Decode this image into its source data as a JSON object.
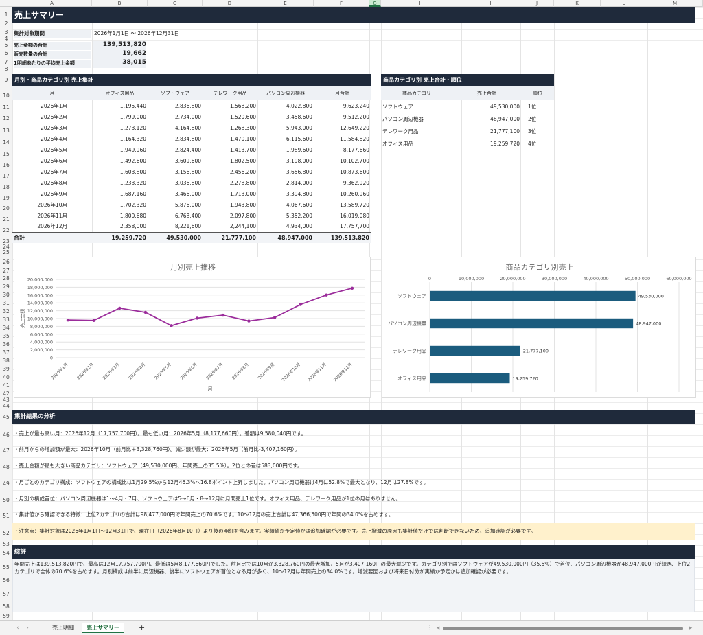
{
  "columns": [
    "A",
    "B",
    "C",
    "D",
    "E",
    "F",
    "G",
    "H",
    "I",
    "J",
    "K",
    "L",
    "M"
  ],
  "selected_column": "G",
  "rows": [
    "1",
    "2",
    "3",
    "4",
    "5",
    "6",
    "7",
    "8",
    "9",
    "10",
    "11",
    "12",
    "13",
    "14",
    "15",
    "16",
    "17",
    "18",
    "19",
    "20",
    "21",
    "22",
    "23",
    "24",
    "25",
    "26",
    "27",
    "28",
    "29",
    "30",
    "31",
    "32",
    "33",
    "34",
    "35",
    "36",
    "37",
    "38",
    "39",
    "40",
    "41",
    "42",
    "43",
    "44",
    "45",
    "46",
    "47",
    "48",
    "49",
    "50",
    "51",
    "52",
    "53",
    "54",
    "55",
    "56",
    "57",
    "58",
    "59"
  ],
  "title": "売上サマリー",
  "period": {
    "label": "集計対象期間",
    "value": "2026年1月1日 ～ 2026年12月31日"
  },
  "kpis": [
    {
      "label": "売上金額の合計",
      "value": "139,513,820"
    },
    {
      "label": "販売数量の合計",
      "value": "19,662"
    },
    {
      "label": "1明細あたりの平均売上金額",
      "value": "38,015"
    }
  ],
  "monthly": {
    "title": "月別・商品カテゴリ別 売上集計",
    "headers": [
      "月",
      "オフィス用品",
      "ソフトウェア",
      "テレワーク用品",
      "パソコン周辺機器",
      "月合計"
    ],
    "rows": [
      [
        "2026年1月",
        "1,195,440",
        "2,836,800",
        "1,568,200",
        "4,022,800",
        "9,623,240"
      ],
      [
        "2026年2月",
        "1,799,000",
        "2,734,000",
        "1,520,600",
        "3,458,600",
        "9,512,200"
      ],
      [
        "2026年3月",
        "1,273,120",
        "4,164,800",
        "1,268,300",
        "5,943,000",
        "12,649,220"
      ],
      [
        "2026年4月",
        "1,164,320",
        "2,834,800",
        "1,470,100",
        "6,115,600",
        "11,584,820"
      ],
      [
        "2026年5月",
        "1,949,960",
        "2,824,400",
        "1,413,700",
        "1,989,600",
        "8,177,660"
      ],
      [
        "2026年6月",
        "1,492,600",
        "3,609,600",
        "1,802,500",
        "3,198,000",
        "10,102,700"
      ],
      [
        "2026年7月",
        "1,603,800",
        "3,156,800",
        "2,456,200",
        "3,656,800",
        "10,873,600"
      ],
      [
        "2026年8月",
        "1,233,320",
        "3,036,800",
        "2,278,800",
        "2,814,000",
        "9,362,920"
      ],
      [
        "2026年9月",
        "1,687,160",
        "3,466,000",
        "1,713,000",
        "3,394,800",
        "10,260,960"
      ],
      [
        "2026年10月",
        "1,702,320",
        "5,876,000",
        "1,943,800",
        "4,067,600",
        "13,589,720"
      ],
      [
        "2026年11月",
        "1,800,680",
        "6,768,400",
        "2,097,800",
        "5,352,200",
        "16,019,080"
      ],
      [
        "2026年12月",
        "2,358,000",
        "8,221,600",
        "2,244,100",
        "4,934,000",
        "17,757,700"
      ]
    ],
    "total": [
      "合計",
      "19,259,720",
      "49,530,000",
      "21,777,100",
      "48,947,000",
      "139,513,820"
    ]
  },
  "category": {
    "title": "商品カテゴリ別 売上合計・順位",
    "headers": [
      "商品カテゴリ",
      "売上合計",
      "順位"
    ],
    "rows": [
      [
        "ソフトウェア",
        "49,530,000",
        "1位"
      ],
      [
        "パソコン周辺機器",
        "48,947,000",
        "2位"
      ],
      [
        "テレワーク用品",
        "21,777,100",
        "3位"
      ],
      [
        "オフィス用品",
        "19,259,720",
        "4位"
      ]
    ]
  },
  "chart_data": [
    {
      "type": "line",
      "title": "月別売上推移",
      "xlabel": "月",
      "ylabel": "売上金額",
      "categories": [
        "2026年1月",
        "2026年2月",
        "2026年3月",
        "2026年4月",
        "2026年5月",
        "2026年6月",
        "2026年7月",
        "2026年8月",
        "2026年9月",
        "2026年10月",
        "2026年11月",
        "2026年12月"
      ],
      "values": [
        9623240,
        9512200,
        12649220,
        11584820,
        8177660,
        10102700,
        10873600,
        9362920,
        10260960,
        13589720,
        16019080,
        17757700
      ],
      "ylim": [
        0,
        20000000
      ],
      "yticks": [
        "0",
        "2,000,000",
        "4,000,000",
        "6,000,000",
        "8,000,000",
        "10,000,000",
        "12,000,000",
        "14,000,000",
        "16,000,000",
        "18,000,000",
        "20,000,000"
      ],
      "color": "#9b2c9b",
      "grid": true
    },
    {
      "type": "bar",
      "orientation": "horizontal",
      "title": "商品カテゴリ別売上",
      "categories": [
        "ソフトウェア",
        "パソコン周辺機器",
        "テレワーク用品",
        "オフィス用品"
      ],
      "values": [
        49530000,
        48947000,
        21777100,
        19259720
      ],
      "data_labels": [
        "49,530,000",
        "48,947,000",
        "21,777,100",
        "19,259,720"
      ],
      "xlim": [
        0,
        60000000
      ],
      "xticks": [
        "0",
        "10,000,000",
        "20,000,000",
        "30,000,000",
        "40,000,000",
        "50,000,000",
        "60,000,000"
      ],
      "color": "#1b5c7e",
      "grid": true
    }
  ],
  "analysis": {
    "title": "集計結果の分析",
    "items": [
      "・売上が最も高い月：2026年12月（17,757,700円）。最も低い月：2026年5月（8,177,660円）。差額は9,580,040円です。",
      "・前月からの増加額が最大：2026年10月（前月比＋3,328,760円）。減少額が最大：2026年5月（前月比-3,407,160円）。",
      "・売上金額が最も大きい商品カテゴリ：ソフトウェア（49,530,000円、年間売上の35.5%）。2位との差は583,000円です。",
      "・月ごとのカテゴリ構成：ソフトウェアの構成比は1月29.5%から12月46.3%へ16.8ポイント上昇しました。パソコン周辺機器は4月に52.8%で最大となり、12月は27.8%です。",
      "・月別の構成首位：パソコン周辺機器は1～4月・7月、ソフトウェアは5～6月・8～12月に月間売上1位です。オフィス用品、テレワーク用品が1位の月はありません。",
      "・集計値から確認できる特徴：上位2カテゴリの合計は98,477,000円で年間売上の70.6%です。10～12月の売上合計は47,366,500円で年間の34.0%を占めます。"
    ],
    "caution": "・注意点：集計対象は2026年1月1日～12月31日で、現在日（2026年8月10日）より後の明細を含みます。実績値か予定値かは追加確認が必要です。売上増減の原因も集計値だけでは判断できないため、追加確認が必要です。"
  },
  "summary": {
    "title": "総評",
    "text": "年間売上は139,513,820円で、最高は12月17,757,700円、最低は5月8,177,660円でした。前月比では10月が3,328,760円の最大増加、5月が3,407,160円の最大減少です。カテゴリ別ではソフトウェアが49,530,000円（35.5%）で首位、パソコン周辺機器が48,947,000円が続き、上位2カテゴリで全体の70.6%を占めます。月別構成は前半に周辺機器、後半にソフトウェアが首位となる月が多く、10～12月は年間売上の34.0%です。増減要因および将来日付分が実績か予定かは追加確認が必要です。"
  },
  "tabs": [
    "売上明細",
    "売上サマリー"
  ],
  "active_tab": "売上サマリー",
  "add_tab_label": "+"
}
